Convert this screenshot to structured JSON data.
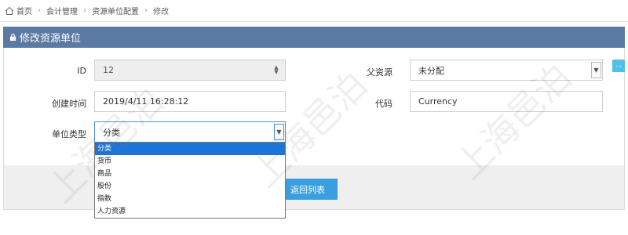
{
  "breadcrumb": {
    "items": [
      "首页",
      "会计管理",
      "资源单位配置",
      "修改"
    ]
  },
  "header": {
    "title": "修改资源单位"
  },
  "form": {
    "id": {
      "label": "ID",
      "value": "12"
    },
    "parent": {
      "label": "父资源",
      "value": "未分配",
      "more_label": "..."
    },
    "created": {
      "label": "创建时间",
      "value": "2019/4/11 16:28:12"
    },
    "code": {
      "label": "代码",
      "value": "Currency"
    },
    "unit_type": {
      "label": "单位类型",
      "value": "分类",
      "options": [
        "分类",
        "货币",
        "商品",
        "股份",
        "指数",
        "人力资源"
      ]
    }
  },
  "actions": {
    "back_label": "返回列表"
  },
  "watermark": {
    "text": "上海邑泊"
  },
  "colors": {
    "header_bg": "#5b7aa3",
    "accent": "#3a9ee0",
    "selected": "#1e73d6"
  }
}
